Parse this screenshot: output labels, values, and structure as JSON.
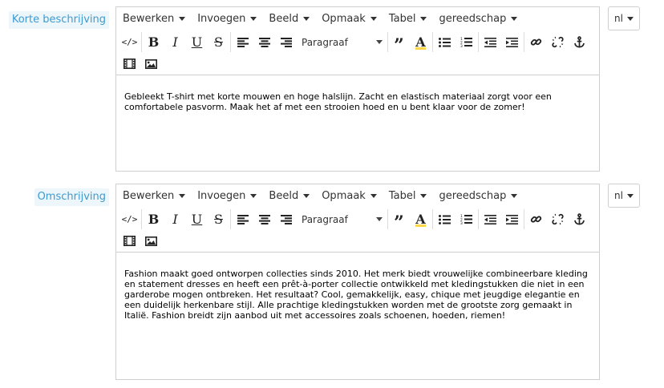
{
  "fields": [
    {
      "label": "Korte beschrijving",
      "lang": "nl",
      "content": "Gebleekt T-shirt met korte mouwen en hoge halslijn. Zacht en elastisch materiaal zorgt voor een comfortabele pasvorm. Maak het af met een strooien hoed en u bent klaar voor de zomer!"
    },
    {
      "label": "Omschrijving",
      "lang": "nl",
      "content": "Fashion maakt goed ontworpen collecties sinds 2010. Het merk biedt vrouwelijke combineerbare kleding en statement dresses en heeft een prêt-à-porter collectie ontwikkeld met kledingstukken die niet in een garderobe mogen ontbreken. Het resultaat? Cool, gemakkelijk, easy, chique met jeugdige elegantie en een duidelijk herkenbare stijl. Alle prachtige kledingstukken worden met de grootste zorg gemaakt in Italië. Fashion breidt zijn aanbod uit met accessoires zoals schoenen, hoeden, riemen!"
    }
  ],
  "menu": {
    "edit": "Bewerken",
    "insert": "Invoegen",
    "view": "Beeld",
    "format": "Opmaak",
    "table": "Tabel",
    "tools": "gereedschap"
  },
  "toolbar": {
    "format_select": "Paragraaf",
    "bold": "B",
    "italic": "I",
    "underline": "U",
    "strike": "S",
    "code": "</>",
    "quote": "”",
    "textcolor": "A"
  }
}
